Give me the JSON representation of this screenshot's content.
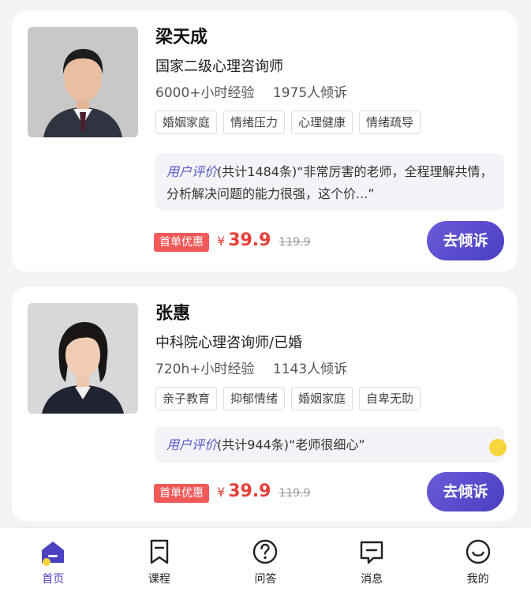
{
  "counselors": [
    {
      "name": "梁天成",
      "title": "国家二级心理咨询师",
      "experience": "6000+小时经验",
      "listeners": "1975人倾诉",
      "tags": [
        "婚姻家庭",
        "情绪压力",
        "心理健康",
        "情绪疏导"
      ],
      "review_label": "用户评价",
      "review_count": "(共计1484条)",
      "review_text": "“非常厉害的老师，全程理解共情，分析解决问题的能力很强，这个价...”",
      "promo_badge": "首单优惠",
      "currency": "¥",
      "price": "39.9",
      "old_price": "119.9",
      "cta_label": "去倾诉"
    },
    {
      "name": "张惠",
      "title": "中科院心理咨询师/已婚",
      "experience": "720h+小时经验",
      "listeners": "1143人倾诉",
      "tags": [
        "亲子教育",
        "抑郁情绪",
        "婚姻家庭",
        "自卑无助"
      ],
      "review_label": "用户评价",
      "review_count": "(共计944条)",
      "review_text": "“老师很细心”",
      "promo_badge": "首单优惠",
      "currency": "¥",
      "price": "39.9",
      "old_price": "119.9",
      "cta_label": "去倾诉"
    }
  ],
  "tabbar": [
    {
      "label": "首页",
      "icon": "home-icon",
      "active": true
    },
    {
      "label": "课程",
      "icon": "bookmark-icon",
      "active": false
    },
    {
      "label": "问答",
      "icon": "question-icon",
      "active": false
    },
    {
      "label": "消息",
      "icon": "message-icon",
      "active": false
    },
    {
      "label": "我的",
      "icon": "smile-icon",
      "active": false
    }
  ],
  "colors": {
    "accent": "#4b3fc2",
    "price": "#e8403b",
    "badge": "#f25a5a",
    "review_bg": "#f3f3f8",
    "review_label": "#5b57c9"
  }
}
